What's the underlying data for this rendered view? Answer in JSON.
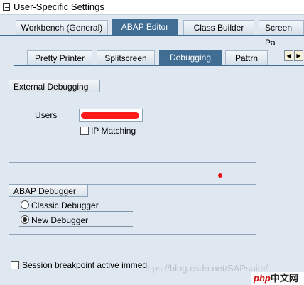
{
  "window": {
    "title": "User-Specific Settings"
  },
  "main_tabs": [
    {
      "label": "Workbench (General)",
      "active": false
    },
    {
      "label": "ABAP Editor",
      "active": true
    },
    {
      "label": "Class Builder",
      "active": false
    },
    {
      "label": "Screen Pa",
      "active": false
    }
  ],
  "sub_tabs": [
    {
      "label": "Pretty Printer",
      "active": false
    },
    {
      "label": "Splitscreen",
      "active": false
    },
    {
      "label": "Debugging",
      "active": true
    },
    {
      "label": "Pattrn",
      "active": false
    }
  ],
  "external_debugging": {
    "title": "External Debugging",
    "users_label": "Users",
    "ip_matching_label": "IP Matching",
    "ip_matching_checked": false
  },
  "abap_debugger": {
    "title": "ABAP Debugger",
    "options": [
      {
        "label": "Classic Debugger",
        "selected": false
      },
      {
        "label": "New Debugger",
        "selected": true
      }
    ]
  },
  "session_breakpoint": {
    "label": "Session breakpoint active immed.",
    "checked": false
  },
  "watermark": "https://blog.csdn.net/SAPsuite/",
  "logo": {
    "php": "php",
    "zh": "中文网"
  }
}
